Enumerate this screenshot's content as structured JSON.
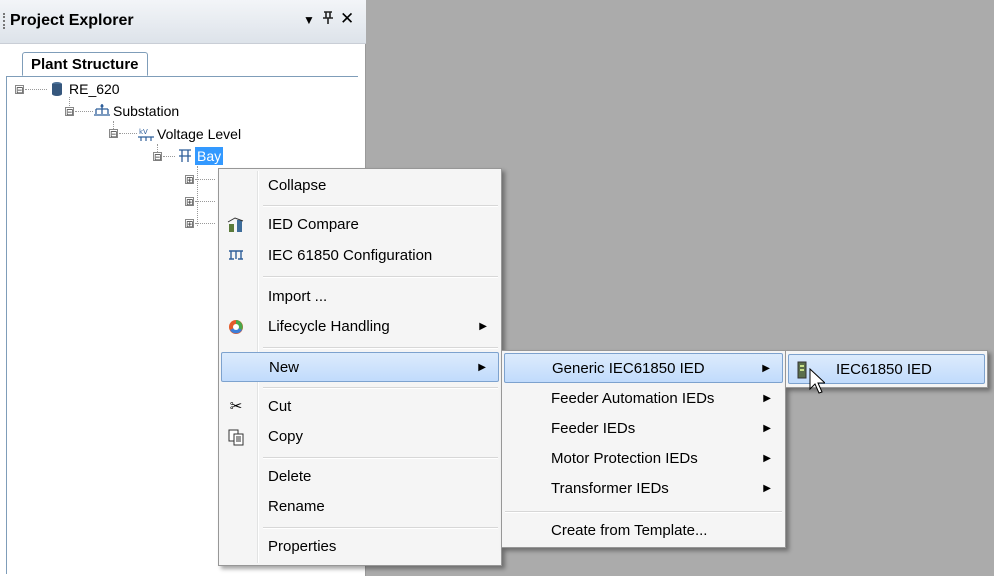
{
  "explorer": {
    "title": "Project Explorer",
    "tab": "Plant Structure"
  },
  "tree": {
    "root": "RE_620",
    "substation": "Substation",
    "voltage_level": "Voltage Level",
    "bay": "Bay"
  },
  "context_menu": {
    "collapse": "Collapse",
    "ied_compare": "IED Compare",
    "iec_config": "IEC 61850 Configuration",
    "import": "Import ...",
    "lifecycle": "Lifecycle Handling",
    "new": "New",
    "cut": "Cut",
    "copy": "Copy",
    "delete": "Delete",
    "rename": "Rename",
    "properties": "Properties"
  },
  "new_submenu": {
    "generic": "Generic IEC61850 IED",
    "feeder_automation": "Feeder Automation IEDs",
    "feeder": "Feeder IEDs",
    "motor": "Motor Protection IEDs",
    "transformer": "Transformer IEDs",
    "template": "Create from Template..."
  },
  "generic_submenu": {
    "iec61850_ied": "IEC61850 IED"
  },
  "icons": {
    "hdr_dropdown": "▼",
    "hdr_pin": "ᴨ",
    "hdr_close": "✕",
    "submenu_arrow": "▶",
    "collapse": "⊟",
    "expand": "⊞",
    "cut": "✂"
  },
  "colors": {
    "highlight": "#c1dbfc",
    "highlight_border": "#7da2ce",
    "bay_selection": "#3399ff"
  }
}
